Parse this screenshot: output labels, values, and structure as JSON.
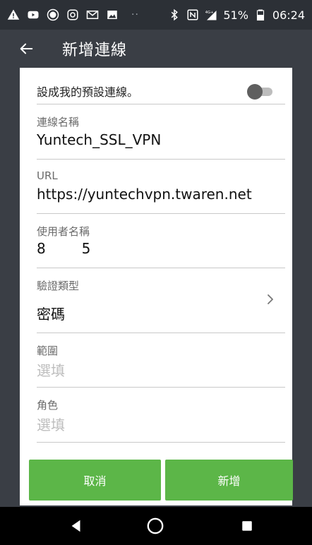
{
  "status_bar": {
    "dots": "··",
    "signal_label": "4G+",
    "battery": "51%",
    "time": "06:24"
  },
  "app_bar": {
    "title": "新增連線"
  },
  "form": {
    "default_label": "設成我的預設連線。",
    "default_enabled": false,
    "name": {
      "label": "連線名稱",
      "value": "Yuntech_SSL_VPN"
    },
    "url": {
      "label": "URL",
      "value": "https://yuntechvpn.twaren.net"
    },
    "username": {
      "label": "使用者名稱",
      "value": "8        5"
    },
    "auth_type": {
      "label": "驗證類型",
      "value": "密碼"
    },
    "scope": {
      "label": "範圍",
      "placeholder": "選填"
    },
    "role": {
      "label": "角色",
      "placeholder": "選填"
    }
  },
  "buttons": {
    "cancel": "取消",
    "add": "新增"
  },
  "colors": {
    "accent_green": "#5cb648",
    "app_bar": "#3a3e45",
    "status_bar": "#2c3036"
  }
}
